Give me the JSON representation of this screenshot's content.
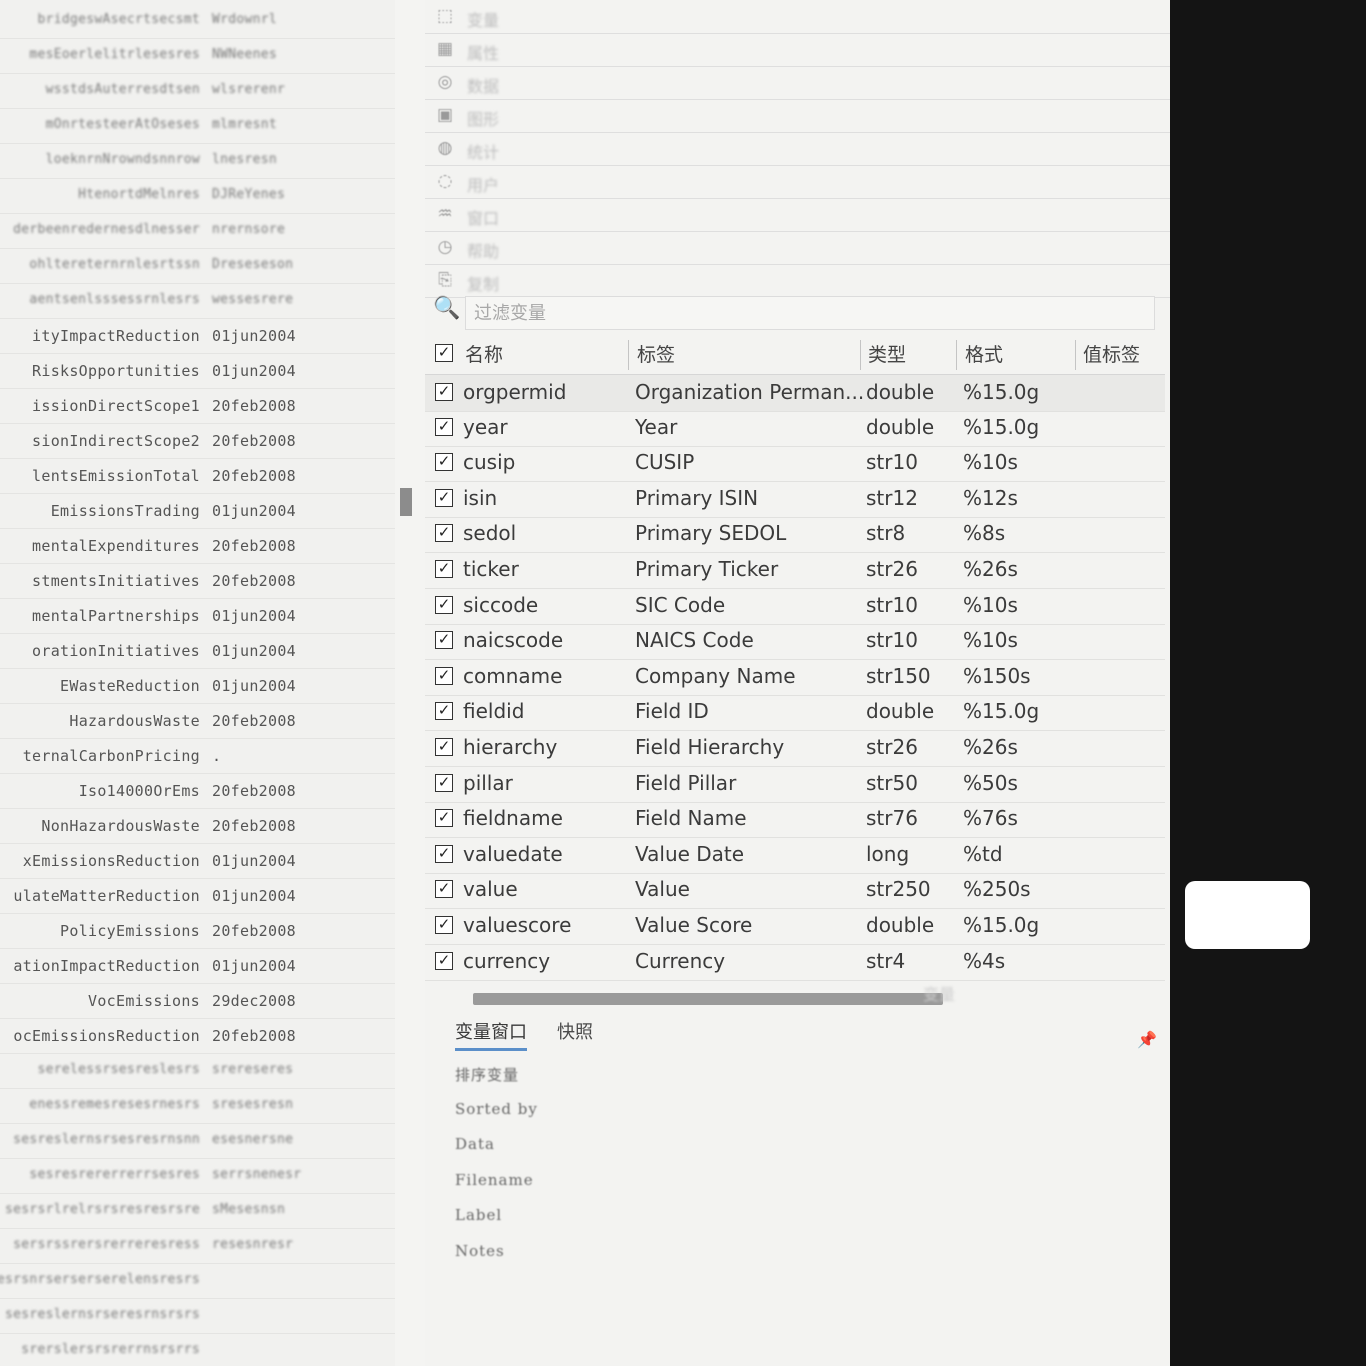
{
  "left_list": [
    {
      "name": "bridgeswAsecrtsecsmt",
      "date": "Wrdownrl",
      "blur": true
    },
    {
      "name": "mesEoerlelitrlesesres",
      "date": "NWNeenes",
      "blur": true
    },
    {
      "name": "wsstdsAuterresdtsen",
      "date": "wlsrerenr",
      "blur": true
    },
    {
      "name": "mOnrtesteerAtOseses",
      "date": "mlmresnt",
      "blur": true
    },
    {
      "name": "loeknrnNrowndsnnrow",
      "date": "lnesresn",
      "blur": true
    },
    {
      "name": "HtenortdMelnres",
      "date": "DJReYenes",
      "blur": true
    },
    {
      "name": "derbeenredernesdlnesser",
      "date": "nrernsore",
      "blur": true
    },
    {
      "name": "ohltereternrnlesrtssn",
      "date": "Dreseseson",
      "blur": true
    },
    {
      "name": "aentsenlsssessrnlesrs",
      "date": "wessesrere",
      "blur": true
    },
    {
      "name": "ityImpactReduction",
      "date": "01jun2004",
      "blur": false
    },
    {
      "name": "RisksOpportunities",
      "date": "01jun2004",
      "blur": false
    },
    {
      "name": "issionDirectScope1",
      "date": "20feb2008",
      "blur": false
    },
    {
      "name": "sionIndirectScope2",
      "date": "20feb2008",
      "blur": false
    },
    {
      "name": "lentsEmissionTotal",
      "date": "20feb2008",
      "blur": false
    },
    {
      "name": "EmissionsTrading",
      "date": "01jun2004",
      "blur": false
    },
    {
      "name": "mentalExpenditures",
      "date": "20feb2008",
      "blur": false
    },
    {
      "name": "stmentsInitiatives",
      "date": "20feb2008",
      "blur": false
    },
    {
      "name": "mentalPartnerships",
      "date": "01jun2004",
      "blur": false
    },
    {
      "name": "orationInitiatives",
      "date": "01jun2004",
      "blur": false
    },
    {
      "name": "EWasteReduction",
      "date": "01jun2004",
      "blur": false
    },
    {
      "name": "HazardousWaste",
      "date": "20feb2008",
      "blur": false
    },
    {
      "name": "ternalCarbonPricing",
      "date": ".",
      "blur": false
    },
    {
      "name": "Iso14000OrEms",
      "date": "20feb2008",
      "blur": false
    },
    {
      "name": "NonHazardousWaste",
      "date": "20feb2008",
      "blur": false
    },
    {
      "name": "xEmissionsReduction",
      "date": "01jun2004",
      "blur": false
    },
    {
      "name": "ulateMatterReduction",
      "date": "01jun2004",
      "blur": false
    },
    {
      "name": "PolicyEmissions",
      "date": "20feb2008",
      "blur": false
    },
    {
      "name": "ationImpactReduction",
      "date": "01jun2004",
      "blur": false
    },
    {
      "name": "VocEmissions",
      "date": "29dec2008",
      "blur": false
    },
    {
      "name": "ocEmissionsReduction",
      "date": "20feb2008",
      "blur": false
    },
    {
      "name": "serelessrsesreslesrs",
      "date": "srereseres",
      "blur": true
    },
    {
      "name": "enessremesresesrnesrs",
      "date": "sresesresn",
      "blur": true
    },
    {
      "name": "sesreslernsrsesresrnsnn",
      "date": "esesnersne",
      "blur": true
    },
    {
      "name": "sesresrererrerrsesres",
      "date": "serrsnenesr",
      "blur": true
    },
    {
      "name": "sesrsrlrelrsrsresresrsre",
      "date": "sMesesnsn",
      "blur": true
    },
    {
      "name": "sersrssrersrerreresress",
      "date": "resesnresr",
      "blur": true
    },
    {
      "name": "sesrsnrserserserelensresrs",
      "date": "",
      "blur": true
    },
    {
      "name": "sesreslernsrseresrnsrsrs",
      "date": "",
      "blur": true
    },
    {
      "name": "srerslersrsrerrnsrsrrs",
      "date": "",
      "blur": true
    }
  ],
  "menu": [
    {
      "icon": "⬚",
      "label": "变量",
      "name": "menu-item-1"
    },
    {
      "icon": "▦",
      "label": "属性",
      "name": "menu-item-2"
    },
    {
      "icon": "◎",
      "label": "数据",
      "name": "menu-item-3"
    },
    {
      "icon": "▣",
      "label": "图形",
      "name": "menu-item-4"
    },
    {
      "icon": "◍",
      "label": "统计",
      "name": "menu-item-5"
    },
    {
      "icon": "◌",
      "label": "用户",
      "name": "menu-item-6"
    },
    {
      "icon": "♒",
      "label": "窗口",
      "name": "menu-item-7"
    },
    {
      "icon": "◷",
      "label": "帮助",
      "name": "menu-item-8"
    },
    {
      "icon": "⎘",
      "label": "复制",
      "name": "menu-item-9"
    }
  ],
  "filter": {
    "placeholder": "过滤变量"
  },
  "columns": {
    "name": "名称",
    "label": "标签",
    "type": "类型",
    "format": "格式",
    "value_label": "值标签"
  },
  "variables": [
    {
      "name": "orgpermid",
      "label": "Organization Perman...",
      "type": "double",
      "format": "%15.0g"
    },
    {
      "name": "year",
      "label": "Year",
      "type": "double",
      "format": "%15.0g"
    },
    {
      "name": "cusip",
      "label": "CUSIP",
      "type": "str10",
      "format": "%10s"
    },
    {
      "name": "isin",
      "label": "Primary ISIN",
      "type": "str12",
      "format": "%12s"
    },
    {
      "name": "sedol",
      "label": "Primary SEDOL",
      "type": "str8",
      "format": "%8s"
    },
    {
      "name": "ticker",
      "label": "Primary Ticker",
      "type": "str26",
      "format": "%26s"
    },
    {
      "name": "siccode",
      "label": "SIC Code",
      "type": "str10",
      "format": "%10s"
    },
    {
      "name": "naicscode",
      "label": "NAICS Code",
      "type": "str10",
      "format": "%10s"
    },
    {
      "name": "comname",
      "label": "Company Name",
      "type": "str150",
      "format": "%150s"
    },
    {
      "name": "fieldid",
      "label": "Field ID",
      "type": "double",
      "format": "%15.0g"
    },
    {
      "name": "hierarchy",
      "label": "Field Hierarchy",
      "type": "str26",
      "format": "%26s"
    },
    {
      "name": "pillar",
      "label": "Field Pillar",
      "type": "str50",
      "format": "%50s"
    },
    {
      "name": "fieldname",
      "label": "Field Name",
      "type": "str76",
      "format": "%76s"
    },
    {
      "name": "valuedate",
      "label": "Value Date",
      "type": "long",
      "format": "%td"
    },
    {
      "name": "value",
      "label": "Value",
      "type": "str250",
      "format": "%250s"
    },
    {
      "name": "valuescore",
      "label": "Value Score",
      "type": "double",
      "format": "%15.0g"
    },
    {
      "name": "currency",
      "label": "Currency",
      "type": "str4",
      "format": "%4s"
    }
  ],
  "scroll_ghost": "变量",
  "tabs": {
    "variables": "变量窗口",
    "snapshot": "快照"
  },
  "properties": [
    "排序变量",
    "Sorted by",
    "Data",
    "Filename",
    "Label",
    "Notes"
  ],
  "colors": {
    "accent": "#5b8fc9",
    "panel_bg": "#f3f3f1",
    "edge": "#141414"
  }
}
